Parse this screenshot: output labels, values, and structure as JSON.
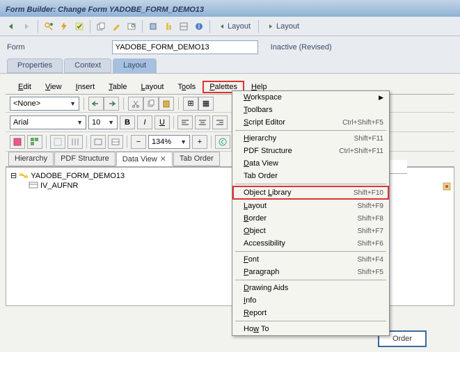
{
  "title": "Form Builder: Change Form YADOBE_FORM_DEMO13",
  "form_label": "Form",
  "form_value": "YADOBE_FORM_DEMO13",
  "form_status": "Inactive (Revised)",
  "top_tabs": {
    "properties": "Properties",
    "context": "Context",
    "layout": "Layout"
  },
  "layout_buttons": {
    "btn1": "Layout",
    "btn2": "Layout"
  },
  "menu": {
    "edit": "Edit",
    "view": "View",
    "insert": "Insert",
    "table": "Table",
    "layout": "Layout",
    "tools": "Tools",
    "palettes": "Palettes",
    "help": "Help"
  },
  "combo_none": "<None>",
  "font_name": "Arial",
  "font_size": "10",
  "zoom": "134%",
  "inner_tabs": {
    "hierarchy": "Hierarchy",
    "pdf": "PDF Structure",
    "dataview": "Data View",
    "taborder": "Tab Order"
  },
  "tree_root": "YADOBE_FORM_DEMO13",
  "tree_child": "IV_AUFNR",
  "dropdown": [
    {
      "label": "Workspace",
      "shortcut": "",
      "arrow": true,
      "u": 0
    },
    {
      "label": "Toolbars",
      "shortcut": "",
      "u": 0
    },
    {
      "label": "Script Editor",
      "shortcut": "Ctrl+Shift+F5",
      "u": 0
    },
    {
      "sep": true
    },
    {
      "label": "Hierarchy",
      "shortcut": "Shift+F11",
      "u": 0
    },
    {
      "label": "PDF Structure",
      "shortcut": "Ctrl+Shift+F11",
      "u": "-1"
    },
    {
      "label": "Data View",
      "shortcut": "",
      "u": 0
    },
    {
      "label": "Tab Order",
      "shortcut": "",
      "u": "-1"
    },
    {
      "sep": true
    },
    {
      "label": "Object Library",
      "shortcut": "Shift+F10",
      "u": 7,
      "hl": true
    },
    {
      "label": "Layout",
      "shortcut": "Shift+F9",
      "u": 0
    },
    {
      "label": "Border",
      "shortcut": "Shift+F8",
      "u": 0
    },
    {
      "label": "Object",
      "shortcut": "Shift+F7",
      "u": 0
    },
    {
      "label": "Accessibility",
      "shortcut": "Shift+F6",
      "u": "-1"
    },
    {
      "sep": true
    },
    {
      "label": "Font",
      "shortcut": "Shift+F4",
      "u": 0
    },
    {
      "label": "Paragraph",
      "shortcut": "Shift+F5",
      "u": 0
    },
    {
      "sep": true
    },
    {
      "label": "Drawing Aids",
      "shortcut": "",
      "u": 0
    },
    {
      "label": "Info",
      "shortcut": "",
      "u": 0
    },
    {
      "label": "Report",
      "shortcut": "",
      "u": 0
    },
    {
      "sep": true
    },
    {
      "label": "How To",
      "shortcut": "",
      "u": 2
    }
  ],
  "order_text": "Order"
}
